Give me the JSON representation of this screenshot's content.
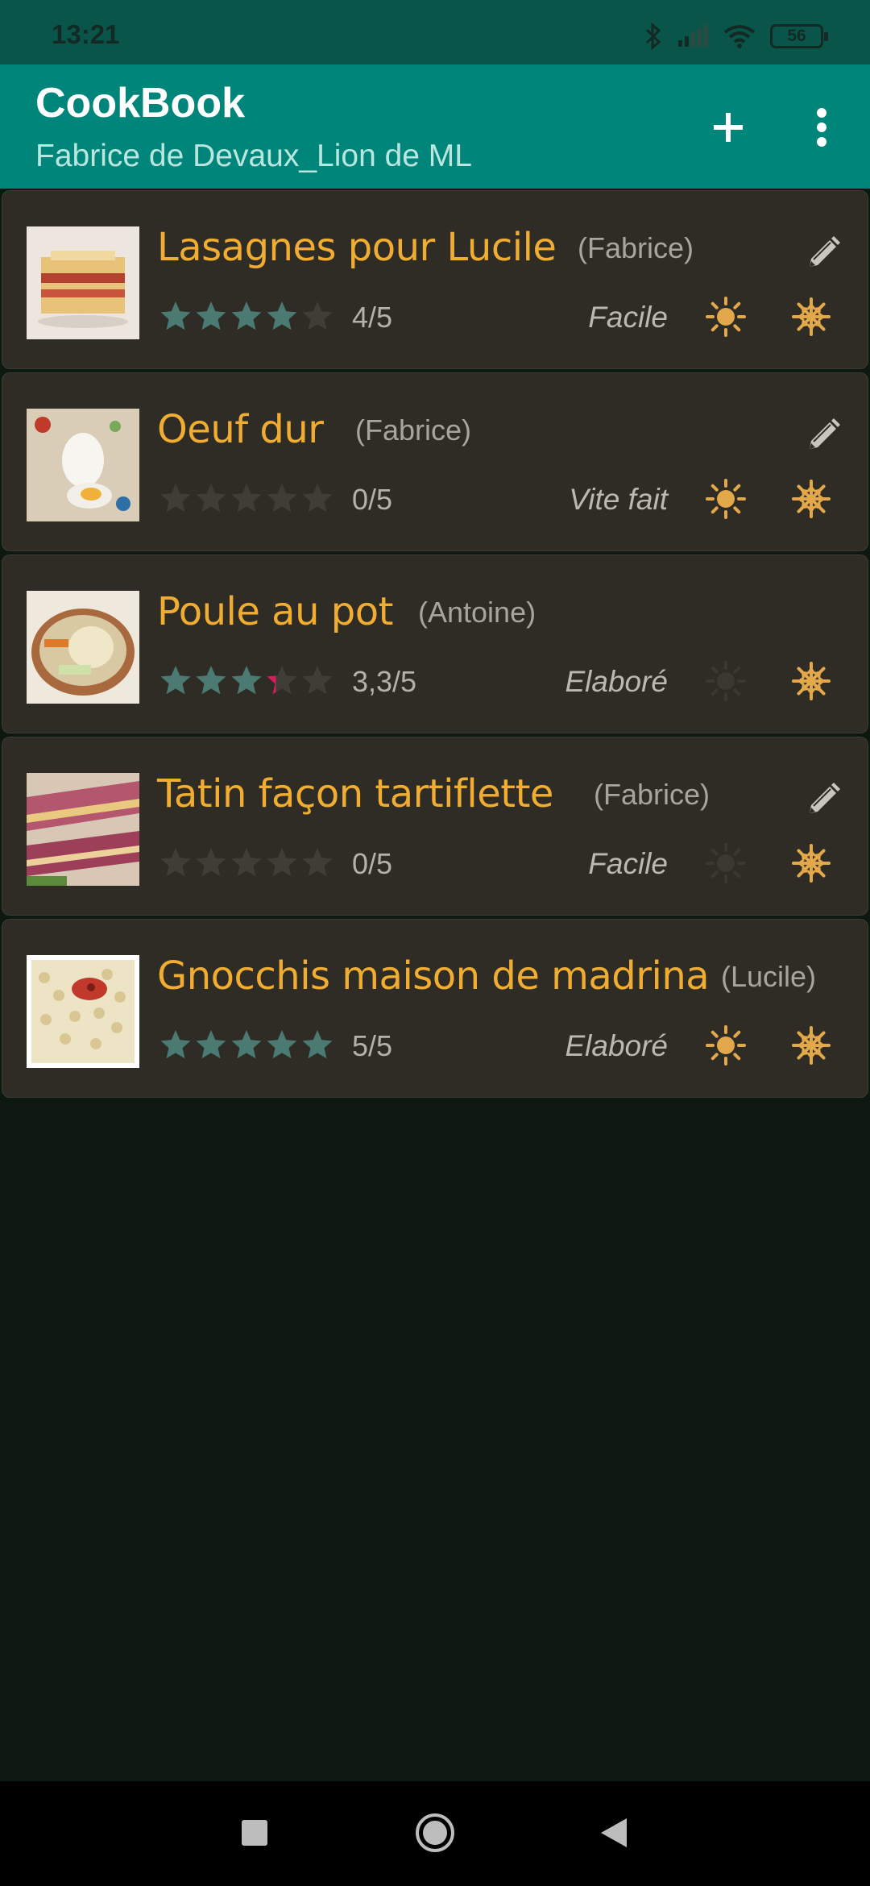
{
  "status_bar": {
    "time": "13:21",
    "battery": "56"
  },
  "app_bar": {
    "title": "CookBook",
    "subtitle": "Fabrice de Devaux_Lion de ML",
    "add_icon": "plus-icon",
    "menu_icon": "more-vert-icon"
  },
  "colors": {
    "primary": "#00857a",
    "status_bar": "#0a5549",
    "background": "#0d1910",
    "card": "#2e2c24",
    "title_text": "#f0ad32",
    "star_on": "#4a7a72",
    "star_off": "#3e3d36",
    "season_on": "#e3a84a",
    "season_off": "#3a3830"
  },
  "recipes": [
    {
      "title": "Lasagnes pour Lucile",
      "author": "(Fabrice)",
      "rating_value": 4,
      "rating": "4/5",
      "difficulty": "Facile",
      "editable": true,
      "summer": true,
      "winter": true,
      "thumb": "lasagna"
    },
    {
      "title": "Oeuf dur",
      "author": "(Fabrice)",
      "rating_value": 0,
      "rating": "0/5",
      "difficulty": "Vite fait",
      "editable": true,
      "summer": true,
      "winter": true,
      "thumb": "egg"
    },
    {
      "title": "Poule au pot",
      "author": "(Antoine)",
      "rating_value": 3.3,
      "rating": "3,3/5",
      "difficulty": "Elaboré",
      "editable": false,
      "summer": false,
      "winter": true,
      "thumb": "chicken"
    },
    {
      "title": "Tatin façon tartiflette",
      "author": "(Fabrice)",
      "rating_value": 0,
      "rating": "0/5",
      "difficulty": "Facile",
      "editable": true,
      "summer": false,
      "winter": true,
      "thumb": "tatin"
    },
    {
      "title": "Gnocchis maison de madrina",
      "author": "(Lucile)",
      "rating_value": 5,
      "rating": "5/5",
      "difficulty": "Elaboré",
      "editable": false,
      "summer": true,
      "winter": true,
      "thumb": "gnocchi"
    }
  ],
  "nav_bar": {
    "recent_icon": "square-icon",
    "home_icon": "circle-icon",
    "back_icon": "triangle-back-icon"
  }
}
